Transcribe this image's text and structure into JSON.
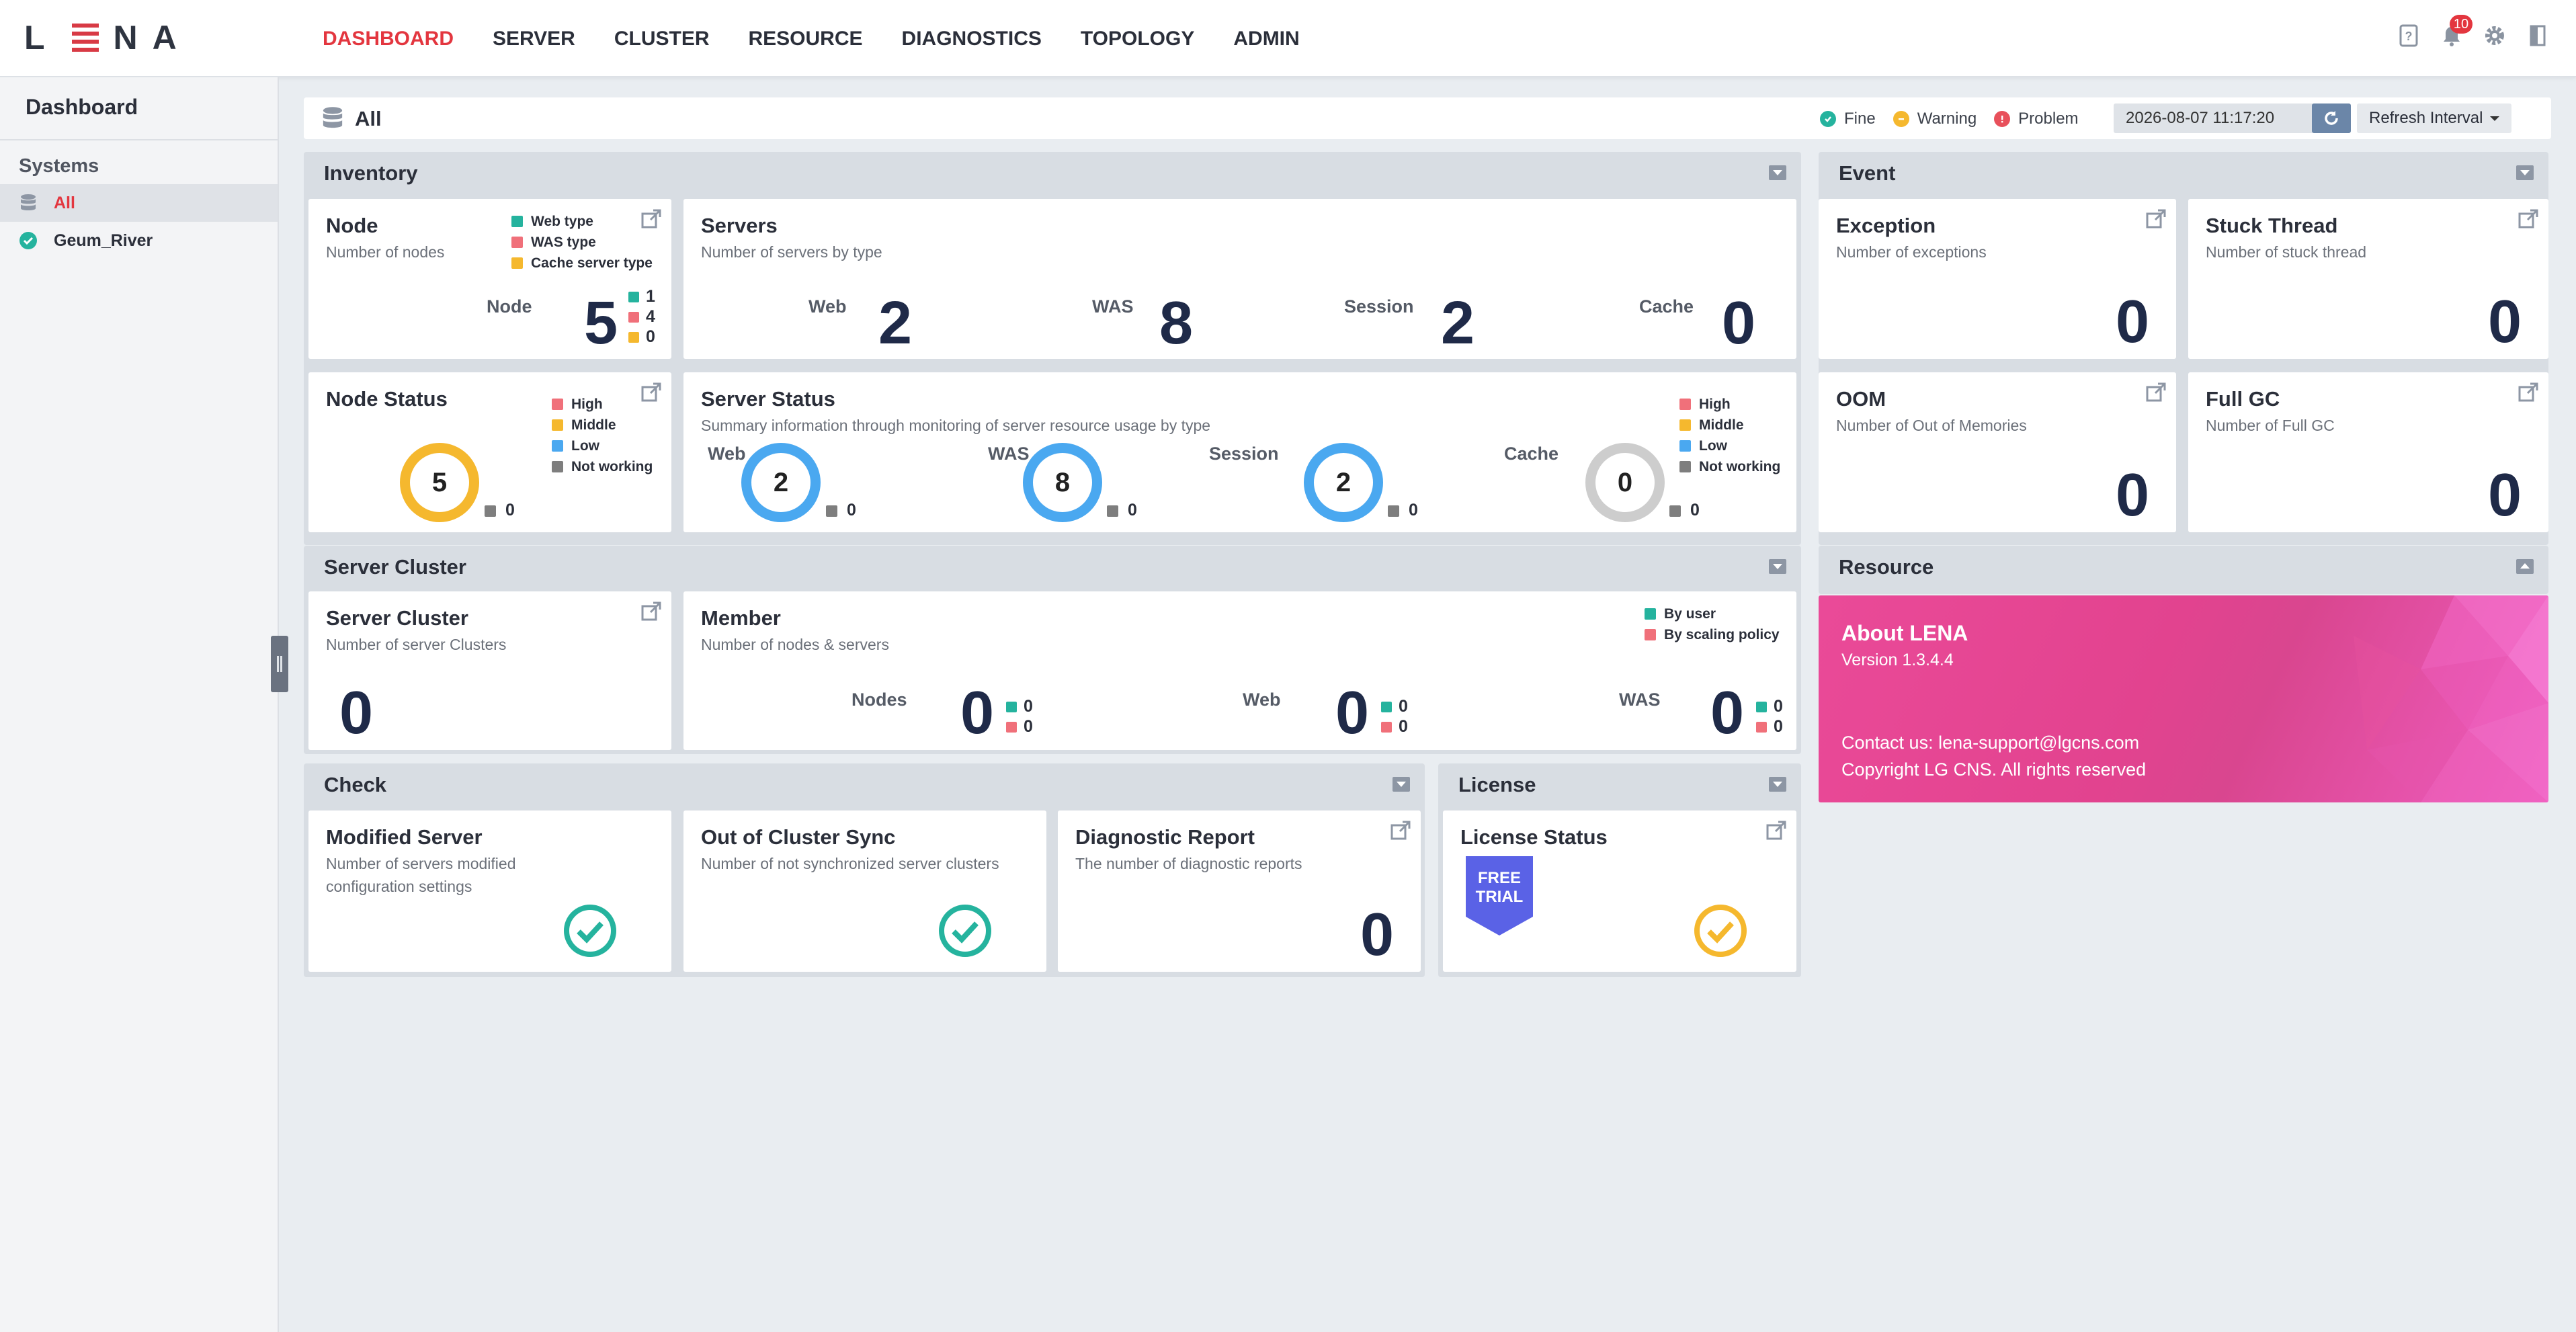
{
  "app": {
    "logo": "LENA"
  },
  "nav": [
    {
      "label": "DASHBOARD",
      "active": true
    },
    {
      "label": "SERVER"
    },
    {
      "label": "CLUSTER"
    },
    {
      "label": "RESOURCE"
    },
    {
      "label": "DIAGNOSTICS"
    },
    {
      "label": "TOPOLOGY"
    },
    {
      "label": "ADMIN"
    }
  ],
  "top_icons": {
    "help": "help-icon",
    "notifications": "bell-icon",
    "notification_count": "10",
    "settings": "gear-icon",
    "logout": "logout-icon"
  },
  "sidebar": {
    "title": "Dashboard",
    "section": "Systems",
    "items": [
      {
        "label": "All",
        "icon": "database-icon",
        "active": true
      },
      {
        "label": "Geum_River",
        "icon": "check-circle-icon"
      }
    ]
  },
  "filter": {
    "scope": "All",
    "status_legend": [
      {
        "label": "Fine",
        "color": "#25b39e"
      },
      {
        "label": "Warning",
        "color": "#f5b82e"
      },
      {
        "label": "Problem",
        "color": "#e8505b"
      }
    ],
    "datetime": "2026-08-07 11:17:20",
    "refresh_interval_label": "Refresh Interval"
  },
  "colors": {
    "teal": "#25b39e",
    "red": "#f0707a",
    "yellow": "#f5b82e",
    "blue": "#4aa8f0",
    "gray": "#7e7e7e",
    "accent": "#e3363f",
    "navy": "#1f2a48"
  },
  "inventory": {
    "title": "Inventory",
    "node": {
      "title": "Node",
      "sub": "Number of nodes",
      "label": "Node",
      "value": "5",
      "legend": [
        "Web type",
        "WAS type",
        "Cache server type"
      ],
      "breakdown": [
        "1",
        "4",
        "0"
      ]
    },
    "servers": {
      "title": "Servers",
      "sub": "Number of servers by type",
      "items": [
        {
          "label": "Web",
          "value": "2"
        },
        {
          "label": "WAS",
          "value": "8"
        },
        {
          "label": "Session",
          "value": "2"
        },
        {
          "label": "Cache",
          "value": "0"
        }
      ]
    },
    "node_status": {
      "title": "Node Status",
      "value": "5",
      "not_working": "0",
      "legend": [
        "High",
        "Middle",
        "Low",
        "Not working"
      ]
    },
    "server_status": {
      "title": "Server Status",
      "sub": "Summary information through monitoring of server resource usage by type",
      "legend": [
        "High",
        "Middle",
        "Low",
        "Not working"
      ],
      "items": [
        {
          "label": "Web",
          "value": "2",
          "not_working": "0"
        },
        {
          "label": "WAS",
          "value": "8",
          "not_working": "0"
        },
        {
          "label": "Session",
          "value": "2",
          "not_working": "0"
        },
        {
          "label": "Cache",
          "value": "0",
          "not_working": "0"
        }
      ]
    }
  },
  "event": {
    "title": "Event",
    "cards": [
      {
        "title": "Exception",
        "sub": "Number of exceptions",
        "value": "0"
      },
      {
        "title": "Stuck Thread",
        "sub": "Number of stuck thread",
        "value": "0"
      },
      {
        "title": "OOM",
        "sub": "Number of Out of Memories",
        "value": "0"
      },
      {
        "title": "Full GC",
        "sub": "Number of Full GC",
        "value": "0"
      }
    ]
  },
  "cluster": {
    "title": "Server Cluster",
    "server_cluster": {
      "title": "Server Cluster",
      "sub": "Number of server Clusters",
      "value": "0"
    },
    "member": {
      "title": "Member",
      "sub": "Number of nodes & servers",
      "legend": [
        "By user",
        "By scaling policy"
      ],
      "items": [
        {
          "label": "Nodes",
          "value": "0",
          "by_user": "0",
          "by_policy": "0"
        },
        {
          "label": "Web",
          "value": "0",
          "by_user": "0",
          "by_policy": "0"
        },
        {
          "label": "WAS",
          "value": "0",
          "by_user": "0",
          "by_policy": "0"
        }
      ]
    }
  },
  "resource": {
    "title": "Resource",
    "about_title": "About LENA",
    "version": "Version 1.3.4.4",
    "contact": "Contact us: lena-support@lgcns.com",
    "copyright": "Copyright LG CNS. All rights reserved"
  },
  "check": {
    "title": "Check",
    "cards": [
      {
        "title": "Modified Server",
        "sub_lines": [
          "Number of servers modified",
          "configuration settings"
        ]
      },
      {
        "title": "Out of Cluster Sync",
        "sub_lines": [
          "Number of not synchronized server clusters"
        ]
      },
      {
        "title": "Diagnostic Report",
        "sub_lines": [
          "The number of diagnostic reports"
        ],
        "value": "0"
      }
    ]
  },
  "license": {
    "title": "License",
    "card_title": "License Status",
    "badge_lines": [
      "FREE",
      "TRIAL"
    ]
  }
}
